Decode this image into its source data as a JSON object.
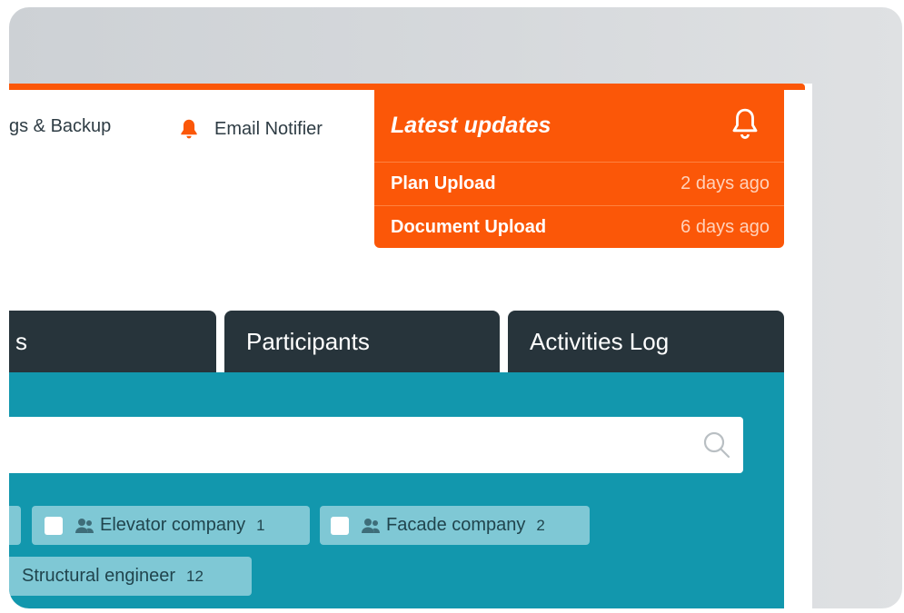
{
  "header": {
    "nav_settings": "gs & Backup",
    "nav_email": "Email Notifier",
    "icons": {
      "email": "bell-icon",
      "updates": "bell-outline-icon"
    }
  },
  "updates": {
    "title": "Latest updates",
    "items": [
      {
        "label": "Plan Upload",
        "time": "2 days ago"
      },
      {
        "label": "Document Upload",
        "time": "6 days ago"
      }
    ]
  },
  "tabs": [
    {
      "label": "s"
    },
    {
      "label": "Participants"
    },
    {
      "label": "Activities Log"
    }
  ],
  "search": {
    "placeholder": "",
    "icon": "search-icon"
  },
  "filters": [
    {
      "label": "Elevator company",
      "count": "1"
    },
    {
      "label": "Facade company",
      "count": "2"
    },
    {
      "label": "Structural engineer",
      "count": "12"
    }
  ],
  "colors": {
    "accent": "#fb5708",
    "tab_bg": "#27343b",
    "panel_bg": "#1297ad",
    "chip_bg": "#7fc8d5"
  }
}
